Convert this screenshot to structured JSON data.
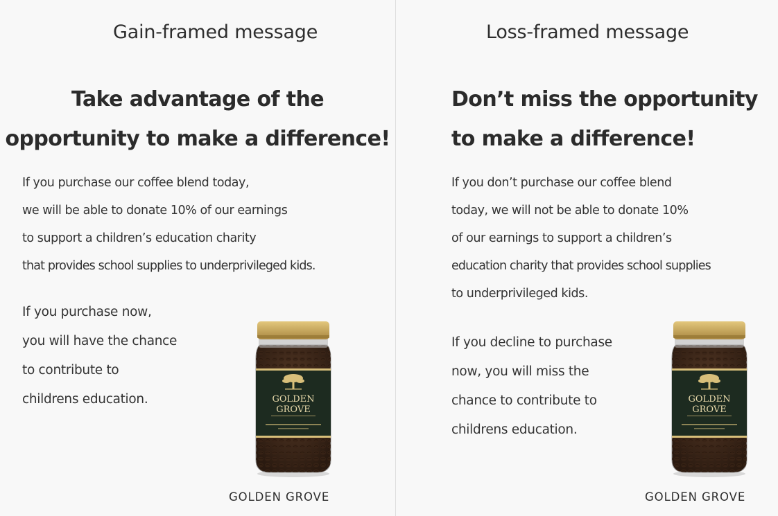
{
  "brand": "GOLDEN GROVE",
  "jar_label": {
    "brand_line1": "GOLDEN",
    "brand_line2": "GROVE",
    "icon": "tree-icon"
  },
  "colors": {
    "background": "#f8f8f8",
    "text": "#2b2b2b",
    "divider": "#dedede",
    "jar_lid": "#c9a75a",
    "jar_label": "#1d2b20",
    "label_gold": "#d8bf7a"
  },
  "panels": [
    {
      "label": "Gain-framed message",
      "headline": [
        "Take advantage of the",
        "opportunity to make a difference!"
      ],
      "body": [
        "If you purchase our coffee blend today,",
        "we will be able to donate 10% of our earnings",
        "to support a children’s education charity",
        "that provides school supplies to underprivileged kids."
      ],
      "call": [
        "If you purchase now,",
        "you will have the chance",
        "to contribute to",
        "childrens education."
      ]
    },
    {
      "label": "Loss-framed message",
      "headline": [
        "Don’t miss the opportunity",
        "to make a difference!"
      ],
      "body": [
        "If you don’t purchase our coffee blend",
        "today, we will not be able to donate 10%",
        "of our earnings to support a children’s",
        "education charity that provides school supplies",
        "to underprivileged kids."
      ],
      "call": [
        "If you decline to purchase",
        "now, you will miss the",
        "chance to contribute to",
        "childrens education."
      ]
    }
  ]
}
